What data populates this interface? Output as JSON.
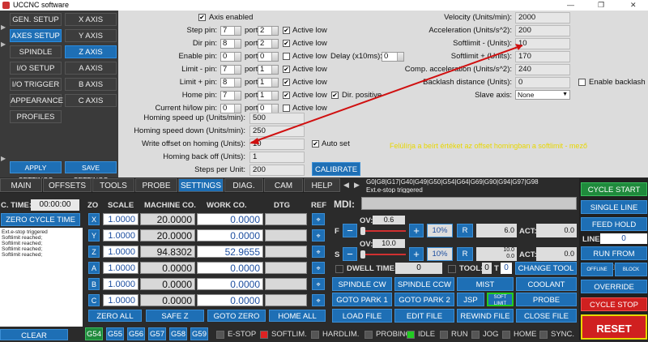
{
  "window": {
    "title": "UCCNC software",
    "minimize": "—",
    "maximize": "❐",
    "close": "✕"
  },
  "left_tabs": [
    "GEN. SETUP",
    "X AXIS",
    "AXES SETUP",
    "Y AXIS",
    "SPINDLE",
    "Z AXIS",
    "I/O SETUP",
    "A AXIS",
    "I/O TRIGGER",
    "B AXIS",
    "APPEARANCE",
    "C AXIS",
    "PROFILES"
  ],
  "left_buttons": {
    "apply": "APPLY SETTINGS",
    "save": "SAVE SETTINGS"
  },
  "axis_settings": {
    "axis_enabled": "Axis enabled",
    "rows": [
      {
        "label": "Step pin:",
        "pin": "7",
        "port": "2",
        "active_low": "Active low"
      },
      {
        "label": "Dir pin:",
        "pin": "8",
        "port": "2",
        "active_low": "Active low"
      },
      {
        "label": "Enable pin:",
        "pin": "0",
        "port": "0",
        "active_low": "Active low"
      },
      {
        "label": "Limit - pin:",
        "pin": "7",
        "port": "1",
        "active_low": "Active low"
      },
      {
        "label": "Limit + pin:",
        "pin": "8",
        "port": "1",
        "active_low": "Active low"
      },
      {
        "label": "Home pin:",
        "pin": "7",
        "port": "1",
        "active_low": "Active low"
      },
      {
        "label": "Current hi/low pin:",
        "pin": "0",
        "port": "0",
        "active_low": "Active low"
      }
    ],
    "port_label": "port:",
    "delay_label": "Delay (x10ms):",
    "delay_value": "0",
    "dir_positive": "Dir. positive",
    "homing_speed_up_label": "Homing speed up (Units/min):",
    "homing_speed_up": "500",
    "homing_speed_down_label": "Homing speed down (Units/min):",
    "homing_speed_down": "250",
    "write_offset_label": "Write offset on homing (Units):",
    "write_offset": "10",
    "auto_set": "Auto set",
    "homing_back_off_label": "Homing back off (Units):",
    "homing_back_off": "1",
    "steps_per_unit_label": "Steps per Unit:",
    "steps_per_unit": "200",
    "calibrate": "CALIBRATE",
    "velocity_label": "Velocity (Units/min):",
    "velocity": "2000",
    "acceleration_label": "Acceleration (Units/s^2):",
    "acceleration": "200",
    "softlimit_minus_label": "Softlimit - (Units):",
    "softlimit_minus": "10",
    "softlimit_plus_label": "Softlimit + (Units):",
    "softlimit_plus": "170",
    "comp_accel_label": "Comp. acceleration (Units/s^2):",
    "comp_accel": "240",
    "backlash_label": "Backlash distance (Units):",
    "backlash": "0",
    "enable_backlash": "Enable backlash",
    "slave_axis_label": "Slave axis:",
    "slave_axis": "None",
    "annotation": "Felülírja a beírt értéket az offset homingban    a softlimit - mező"
  },
  "main_tabs": [
    "MAIN",
    "OFFSETS",
    "TOOLS",
    "PROBE",
    "SETTINGS",
    "DIAG.",
    "CAM",
    "HELP"
  ],
  "gcode_status": {
    "line1": "G0|G8|G17|G40|G49|G50|G54|G64|G69|G90|G94|G97|G98",
    "line2": "Ext.e-stop triggered"
  },
  "cycle_time": {
    "label": "C. TIME:",
    "value": "00:00:00",
    "zero": "ZERO CYCLE TIME"
  },
  "messages": [
    "Ext.e-stop triggered",
    "Softlimit reached;",
    "Softlimit reached;",
    "Softlimit reached;",
    "Softlimit reached;"
  ],
  "dro_headers": {
    "zo": "ZO",
    "scale": "SCALE",
    "machine": "MACHINE CO.",
    "work": "WORK CO.",
    "dtg": "DTG",
    "ref": "REF"
  },
  "axes": [
    {
      "name": "X",
      "scale": "1.0000",
      "machine": "20.0000",
      "work": "0.0000"
    },
    {
      "name": "Y",
      "scale": "1.0000",
      "machine": "20.0000",
      "work": "0.0000"
    },
    {
      "name": "Z",
      "scale": "1.0000",
      "machine": "94.8302",
      "work": "52.9655"
    },
    {
      "name": "A",
      "scale": "1.0000",
      "machine": "0.0000",
      "work": "0.0000"
    },
    {
      "name": "B",
      "scale": "1.0000",
      "machine": "0.0000",
      "work": "0.0000"
    },
    {
      "name": "C",
      "scale": "1.0000",
      "machine": "0.0000",
      "work": "0.0000"
    }
  ],
  "dro_buttons": [
    "ZERO ALL",
    "SAFE Z",
    "GOTO ZERO",
    "HOME ALL"
  ],
  "mdi": {
    "label": "MDI:"
  },
  "feed": {
    "ov_label": "OV:",
    "ov": "0.6",
    "f_label": "F",
    "pct": "10%",
    "r": "R",
    "r_value": "6.0",
    "act": "ACT:",
    "act_value": "0.0"
  },
  "spindle": {
    "ov_label": "OV:",
    "ov": "10.0",
    "s_label": "S",
    "pct": "10%",
    "r": "R",
    "r_value_top": "10.0",
    "r_value": "0.0",
    "act": "ACT:",
    "act_value": "0.0"
  },
  "dwell": {
    "label": "DWELL TIME:",
    "value": "0",
    "tool_label": "TOOL:",
    "tool": "0",
    "t_label": "T",
    "t": "0",
    "change_tool": "CHANGE TOOL"
  },
  "action_buttons": [
    "SPINDLE CW",
    "SPINDLE CCW",
    "MIST",
    "COOLANT",
    "GOTO PARK 1",
    "GOTO PARK 2",
    "JSP",
    "SOFT LIMIT",
    "PROBE",
    "LOAD FILE",
    "EDIT FILE",
    "REWIND FILE",
    "CLOSE FILE"
  ],
  "right_buttons": {
    "cycle_start": "CYCLE START",
    "single_line": "SINGLE LINE",
    "feed_hold": "FEED HOLD",
    "line_label": "LINE:",
    "line": "0",
    "run_from_here": "RUN FROM HERE",
    "offline": "OFFLINE MODE",
    "block_delete": "BLOCK DELETE",
    "override": "OVERRIDE LIMITS",
    "cycle_stop": "CYCLE STOP",
    "reset": "RESET"
  },
  "clear": "CLEAR",
  "g_tabs": [
    "G54",
    "G55",
    "G56",
    "G57",
    "G58",
    "G59"
  ],
  "leds": [
    {
      "label": "E-STOP",
      "color": "#555"
    },
    {
      "label": "SOFTLIM.",
      "color": "#d22"
    },
    {
      "label": "HARDLIM.",
      "color": "#555"
    },
    {
      "label": "PROBING",
      "color": "#555"
    },
    {
      "label": "IDLE",
      "color": "#2c2"
    },
    {
      "label": "RUN",
      "color": "#555"
    },
    {
      "label": "JOG",
      "color": "#555"
    },
    {
      "label": "HOME",
      "color": "#555"
    },
    {
      "label": "SYNC.",
      "color": "#555"
    }
  ],
  "colors": {
    "accent": "#1e6fb5",
    "green": "#1f8a3c",
    "red": "#d02020",
    "annotation": "#e8d700",
    "arrow": "#d01010"
  }
}
